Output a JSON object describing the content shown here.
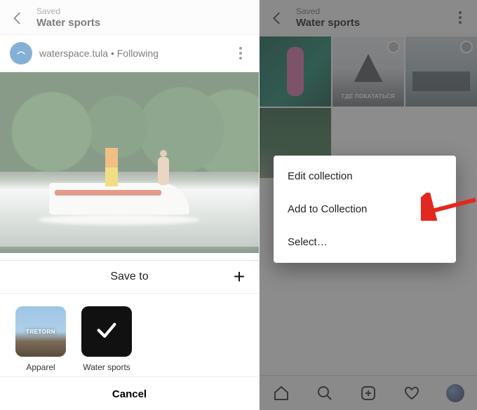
{
  "left": {
    "header": {
      "saved": "Saved",
      "title": "Water sports"
    },
    "post": {
      "username": "waterspace.tula",
      "follow_sep": " • ",
      "follow_state": "Following"
    },
    "sheet": {
      "title": "Save to",
      "collections": [
        {
          "label": "Apparel",
          "brand_overlay": "TRETORN"
        },
        {
          "label": "Water sports"
        }
      ],
      "cancel": "Cancel"
    }
  },
  "right": {
    "header": {
      "saved": "Saved",
      "title": "Water sports"
    },
    "grid_caption_tile2": "ГДЕ ПОКАТАТЬСЯ",
    "popup": {
      "items": [
        "Edit collection",
        "Add to Collection",
        "Select…"
      ]
    }
  }
}
